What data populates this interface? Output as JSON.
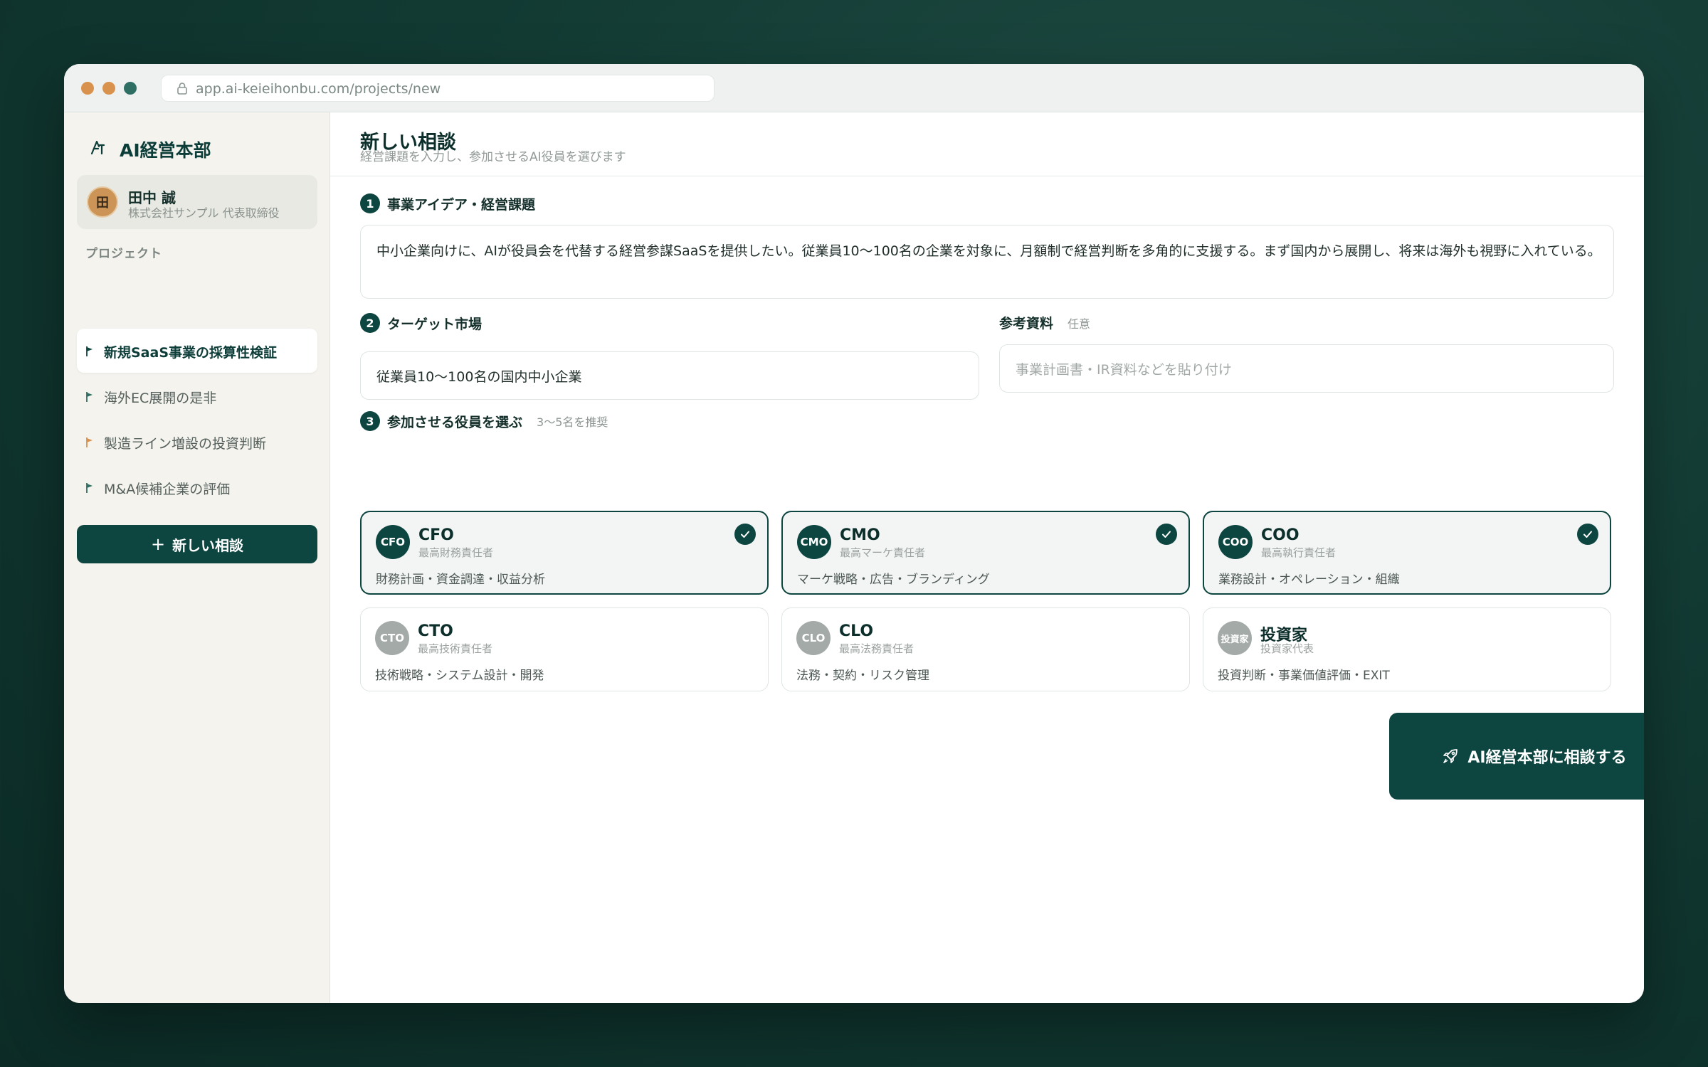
{
  "browser": {
    "url": "app.ai-keieihonbu.com/projects/new"
  },
  "sidebar": {
    "brand": "AI経営本部",
    "user": {
      "initial": "田",
      "name": "田中 誠",
      "role": "株式会社サンプル 代表取締役"
    },
    "section_label": "プロジェクト",
    "projects": [
      {
        "label": "新規SaaS事業の採算性検証",
        "flag_color": "#0d4540",
        "active": true
      },
      {
        "label": "海外EC展開の是非",
        "flag_color": "#2f6e63",
        "active": false
      },
      {
        "label": "製造ライン増設の投資判断",
        "flag_color": "#d8924d",
        "active": false
      },
      {
        "label": "M&A候補企業の評価",
        "flag_color": "#2f6e63",
        "active": false
      }
    ],
    "new_button": "新しい相談"
  },
  "header": {
    "title": "新しい相談",
    "subtitle": "経営課題を入力し、参加させるAI役員を選びます"
  },
  "step1": {
    "num": "1",
    "label": "事業アイデア・経営課題",
    "value": "中小企業向けに、AIが役員会を代替する経営参謀SaaSを提供したい。従業員10〜100名の企業を対象に、月額制で経営判断を多角的に支援する。まず国内から展開し、将来は海外も視野に入れている。"
  },
  "step2": {
    "num": "2",
    "label": "ターゲット市場",
    "value": "従業員10〜100名の国内中小企業"
  },
  "reference": {
    "label": "参考資料",
    "optional": "任意",
    "placeholder": "事業計画書・IR資料などを貼り付け"
  },
  "step3": {
    "num": "3",
    "label": "参加させる役員を選ぶ",
    "hint": "3〜5名を推奨",
    "executives": [
      {
        "abbr": "CFO",
        "name": "CFO",
        "role": "最高財務責任者",
        "desc": "財務計画・資金調達・収益分析",
        "selected": true
      },
      {
        "abbr": "CMO",
        "name": "CMO",
        "role": "最高マーケ責任者",
        "desc": "マーケ戦略・広告・ブランディング",
        "selected": true
      },
      {
        "abbr": "COO",
        "name": "COO",
        "role": "最高執行責任者",
        "desc": "業務設計・オペレーション・組織",
        "selected": true
      },
      {
        "abbr": "CTO",
        "name": "CTO",
        "role": "最高技術責任者",
        "desc": "技術戦略・システム設計・開発",
        "selected": false
      },
      {
        "abbr": "CLO",
        "name": "CLO",
        "role": "最高法務責任者",
        "desc": "法務・契約・リスク管理",
        "selected": false
      },
      {
        "abbr": "投資家",
        "name": "投資家",
        "role": "投資家代表",
        "desc": "投資判断・事業価値評価・EXIT",
        "selected": false
      }
    ]
  },
  "submit_label": "AI経営本部に相談する"
}
